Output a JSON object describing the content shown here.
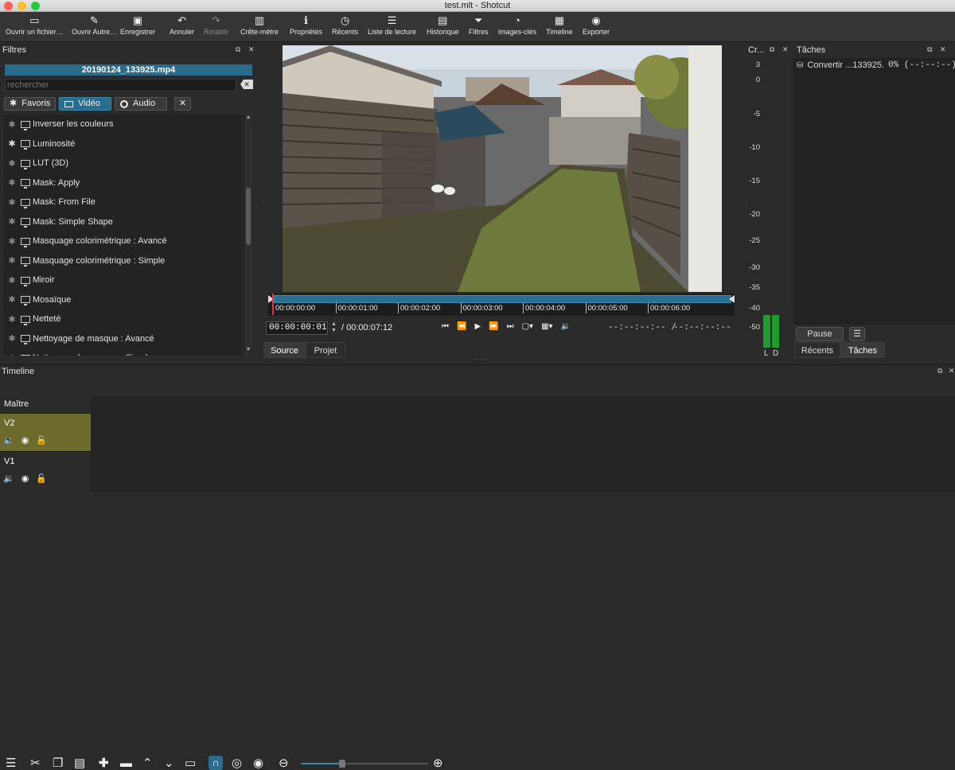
{
  "window": {
    "title": "test.mlt - Shotcut"
  },
  "toolbar": {
    "items": [
      {
        "label": "Ouvrir un fichier…",
        "icon": "open-file-icon",
        "glyph": "▭"
      },
      {
        "label": "Ouvrir Autre…",
        "icon": "open-other-icon",
        "glyph": "✎"
      },
      {
        "label": "Enregistrer",
        "icon": "save-icon",
        "glyph": "▣"
      },
      {
        "label": "Annuler",
        "icon": "undo-icon",
        "glyph": "↶"
      },
      {
        "label": "Rétablir",
        "icon": "redo-icon",
        "glyph": "↷"
      },
      {
        "label": "Crête-mètre",
        "icon": "peak-meter-icon",
        "glyph": "▥"
      },
      {
        "label": "Propriétés",
        "icon": "info-icon",
        "glyph": "ℹ"
      },
      {
        "label": "Récents",
        "icon": "clock-icon",
        "glyph": "◷"
      },
      {
        "label": "Liste de lecture",
        "icon": "playlist-icon",
        "glyph": "☰"
      },
      {
        "label": "Historique",
        "icon": "history-icon",
        "glyph": "▤"
      },
      {
        "label": "Filtres",
        "icon": "filter-icon",
        "glyph": "⏷"
      },
      {
        "label": "images-clés",
        "icon": "keyframes-icon",
        "glyph": "◔"
      },
      {
        "label": "Timeline",
        "icon": "timeline-icon",
        "glyph": "▦"
      },
      {
        "label": "Exporter",
        "icon": "export-icon",
        "glyph": "◉"
      }
    ]
  },
  "filters": {
    "panel_title": "Filtres",
    "current_file": "20190124_133925.mp4",
    "search_placeholder": "rechercher",
    "tabs": {
      "favorites": "Favoris",
      "video": "Vidéo",
      "audio": "Audio",
      "close_glyph": "✕"
    },
    "list": [
      {
        "label": "Inverser les couleurs",
        "fav": false
      },
      {
        "label": "Luminosité",
        "fav": true
      },
      {
        "label": "LUT (3D)",
        "fav": false
      },
      {
        "label": "Mask: Apply",
        "fav": false
      },
      {
        "label": "Mask: From File",
        "fav": false
      },
      {
        "label": "Mask: Simple Shape",
        "fav": false
      },
      {
        "label": "Masquage colorimétrique : Avancé",
        "fav": false
      },
      {
        "label": "Masquage colorimétrique : Simple",
        "fav": false
      },
      {
        "label": "Miroir",
        "fav": false
      },
      {
        "label": "Mosaïque",
        "fav": false
      },
      {
        "label": "Netteté",
        "fav": false
      },
      {
        "label": "Nettoyage de masque : Avancé",
        "fav": false
      },
      {
        "label": "Nettoyage de masque : Simple",
        "fav": false
      }
    ]
  },
  "player": {
    "ruler_labels": [
      "00:00:00:00",
      "00:00:01:00",
      "00:00:02:00",
      "00:00:03:00",
      "00:00:04:00",
      "00:00:05:00",
      "00:00:06:00"
    ],
    "timecode": "00:00:00:01",
    "duration": "/ 00:00:07:12",
    "in_point": "--:--:--:-- /",
    "out_point": "--:--:--:--",
    "tabs": {
      "source": "Source",
      "project": "Projet"
    }
  },
  "meter": {
    "title": "Cr...",
    "scale": [
      "3",
      "0",
      "-5",
      "-10",
      "-15",
      "-20",
      "-25",
      "-30",
      "-35",
      "-40",
      "-50"
    ],
    "channels": [
      "L",
      "D"
    ]
  },
  "jobs": {
    "title": "Tâches",
    "job_name": "Convertir ...133925.",
    "job_status": "0% (--:--:--)",
    "pause_label": "Pause",
    "menu_glyph": "☰",
    "tabs": {
      "recent": "Récents",
      "jobs": "Tâches"
    }
  },
  "timeline": {
    "title": "Timeline",
    "master_label": "Maître",
    "tracks": [
      {
        "name": "V2",
        "selected": true
      },
      {
        "name": "V1",
        "selected": false
      }
    ]
  },
  "colors": {
    "accent": "#2b6d8e",
    "track_selected": "#6c6a2c",
    "meter_green": "#1f9a2c"
  }
}
